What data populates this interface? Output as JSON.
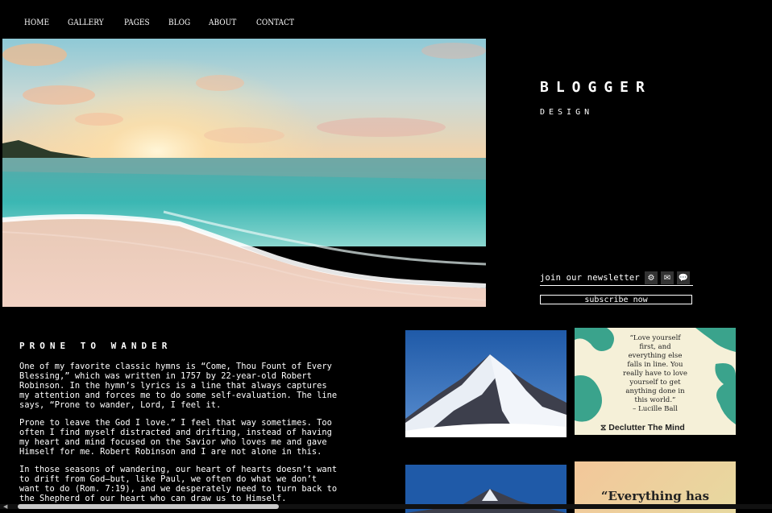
{
  "nav": {
    "items": [
      "HOME",
      "GALLERY",
      "PAGES",
      "BLOG",
      "ABOUT",
      "CONTACT"
    ]
  },
  "brand": {
    "title": "BLOGGER",
    "subtitle": "DESIGN"
  },
  "newsletter": {
    "label": "join our newsletter",
    "icons": [
      "gear-icon",
      "envelope-icon",
      "chat-icon"
    ],
    "subscribe_label": "subscribe now"
  },
  "post": {
    "title": "PRONE TO WANDER",
    "paragraphs": [
      "One of my favorite classic hymns is “Come, Thou Fount of Every Blessing,” which was written in 1757 by 22-year-old Robert Robinson. In the hymn’s lyrics is a line that always captures my attention and forces me to do some self-evaluation. The line says, “Prone to wander, Lord, I feel it.",
      "Prone to leave the God I love.” I feel that way sometimes. Too often I find myself distracted and drifting, instead of having my heart and mind focused on the Savior who loves me and gave Himself for me. Robert Robinson and I are not alone in this.",
      "In those seasons of wandering, our heart of hearts doesn’t want to drift from God—but, like Paul, we often do what we don’t want to do (Rom. 7:19), and we desperately need to turn back to the Shepherd of our heart who can draw us to Himself."
    ]
  },
  "gallery": {
    "quote1": {
      "lines": [
        "“Love yourself",
        "first, and",
        "everything else",
        "falls in line. You",
        "really have to love",
        "yourself to get",
        "anything done in",
        "this world.”",
        "– Lucille Ball"
      ],
      "brand": "Declutter The Mind"
    },
    "quote2": {
      "text": "“Everything has"
    }
  },
  "colors": {
    "background": "#000000",
    "text": "#ffffff",
    "quote_green": "#3aa38c",
    "quote_cream": "#f5f0d8"
  }
}
